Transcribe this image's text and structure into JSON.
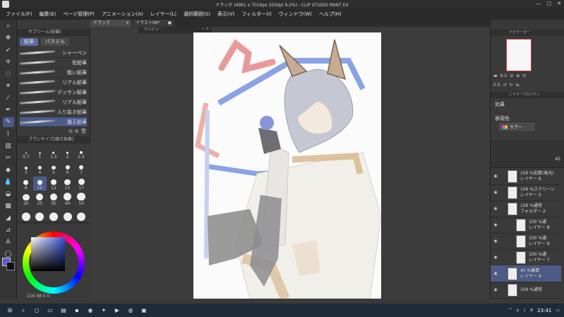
{
  "window": {
    "title": "ドラッグ (4961 x 7016px 350dpi 9.2%) - CLIP STUDIO PAINT EX",
    "minimize": "—",
    "maximize": "□",
    "close": "✕"
  },
  "menu": [
    "ファイル(F)",
    "編集(E)",
    "ページ管理(P)",
    "アニメーション(A)",
    "レイヤー(L)",
    "選択範囲(S)",
    "表示(V)",
    "フィルター(I)",
    "ウィンドウ(W)",
    "ヘルプ(H)"
  ],
  "doc_tabs": [
    {
      "label": "ドラッグ",
      "close": "✕"
    },
    {
      "label": "イラスト98*",
      "close": "●"
    }
  ],
  "subview": {
    "label": "サブビュー",
    "minimize": "—",
    "close": "✕"
  },
  "subtool": {
    "title": "サブツール[鉛筆]",
    "tabs": [
      "鉛筆",
      "パステル"
    ],
    "brushes": [
      "シャーペン",
      "色鉛筆",
      "粗い鉛筆",
      "リアル鉛筆",
      "デッサン鉛筆",
      "リアル鉛筆",
      "入り抜き鉛筆",
      "魔王鉛筆"
    ],
    "selected_index": 7
  },
  "brush_size": {
    "title": "ブラシサイズ[魔王鉛筆]",
    "sizes": [
      "0.7",
      "1",
      "1.5",
      "2",
      "2.5",
      "3",
      "4",
      "5",
      "6",
      "7",
      "8",
      "10",
      "12",
      "15",
      "17",
      "20",
      "25",
      "30",
      "40",
      "50",
      "",
      "",
      "",
      "",
      ""
    ],
    "selected": "10"
  },
  "color": {
    "main": "#5a5ad0",
    "sub": "#111111",
    "readout": "216 68 0 0"
  },
  "navigator": {
    "title": "ナビゲーター",
    "zoom": "9.2",
    "rotation": "0.0"
  },
  "layer_property": {
    "title": "レイヤープロパティ",
    "effect_label": "効果",
    "expression_label": "表現色",
    "expression_value": "カラー"
  },
  "layers": {
    "opacity": "45",
    "items": [
      {
        "line1": "100 %加算(発光)",
        "line2": "レイヤー 6",
        "child": false,
        "selected": false
      },
      {
        "line1": "100 %スクリーン",
        "line2": "レイヤー 5",
        "child": false,
        "selected": false
      },
      {
        "line1": "100 %通常",
        "line2": "フォルダー 2",
        "child": false,
        "selected": false
      },
      {
        "line1": "100 %通",
        "line2": "レイヤー 8",
        "child": true,
        "selected": false
      },
      {
        "line1": "100 %通",
        "line2": "レイヤー 9",
        "child": true,
        "selected": false
      },
      {
        "line1": "100 %通",
        "line2": "レイヤー 7",
        "child": true,
        "selected": false
      },
      {
        "line1": "45 %乗算",
        "line2": "レイヤー 4",
        "child": false,
        "selected": true
      },
      {
        "line1": "100 %通常",
        "line2": "",
        "child": false,
        "selected": false
      }
    ]
  },
  "taskbar": {
    "time": "23:41",
    "lang": "A"
  }
}
